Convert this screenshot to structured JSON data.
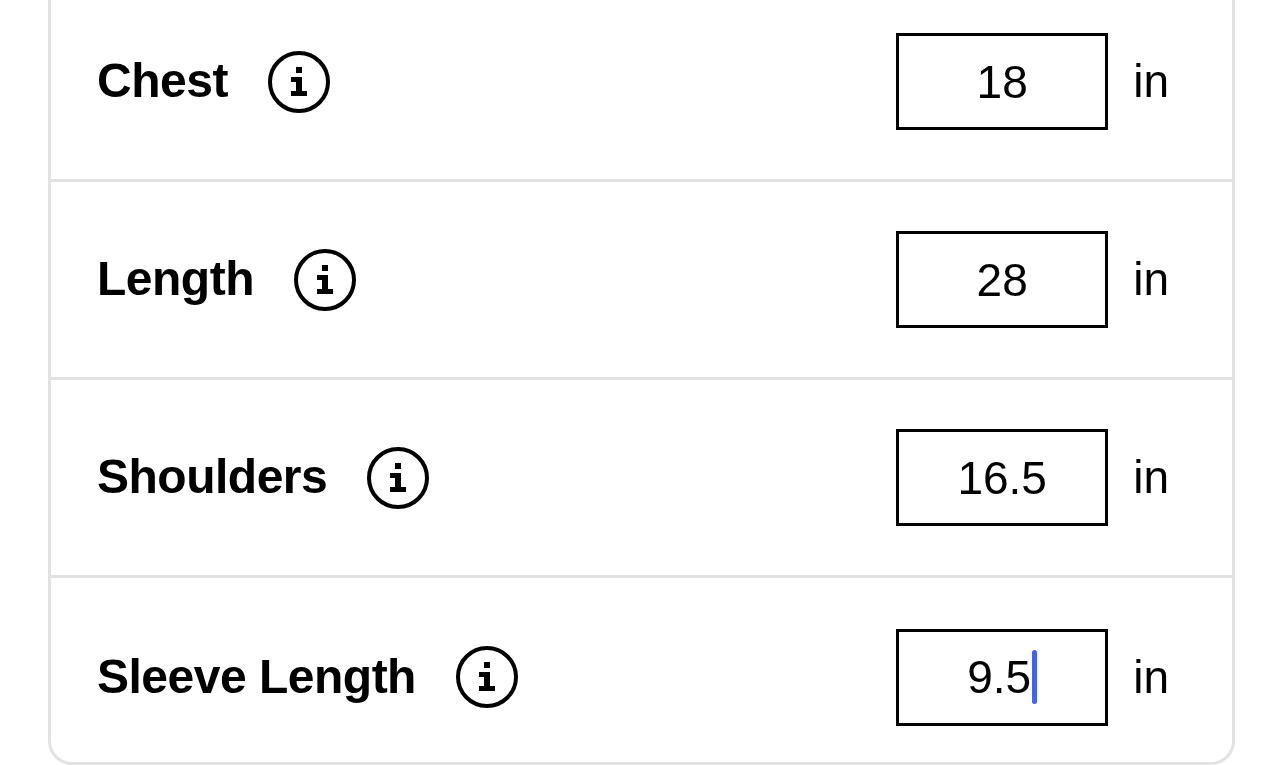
{
  "measurements": [
    {
      "label": "Chest",
      "value": "18",
      "unit": "in",
      "focused": false
    },
    {
      "label": "Length",
      "value": "28",
      "unit": "in",
      "focused": false
    },
    {
      "label": "Shoulders",
      "value": "16.5",
      "unit": "in",
      "focused": false
    },
    {
      "label": "Sleeve Length",
      "value": "9.5",
      "unit": "in",
      "focused": true
    }
  ]
}
